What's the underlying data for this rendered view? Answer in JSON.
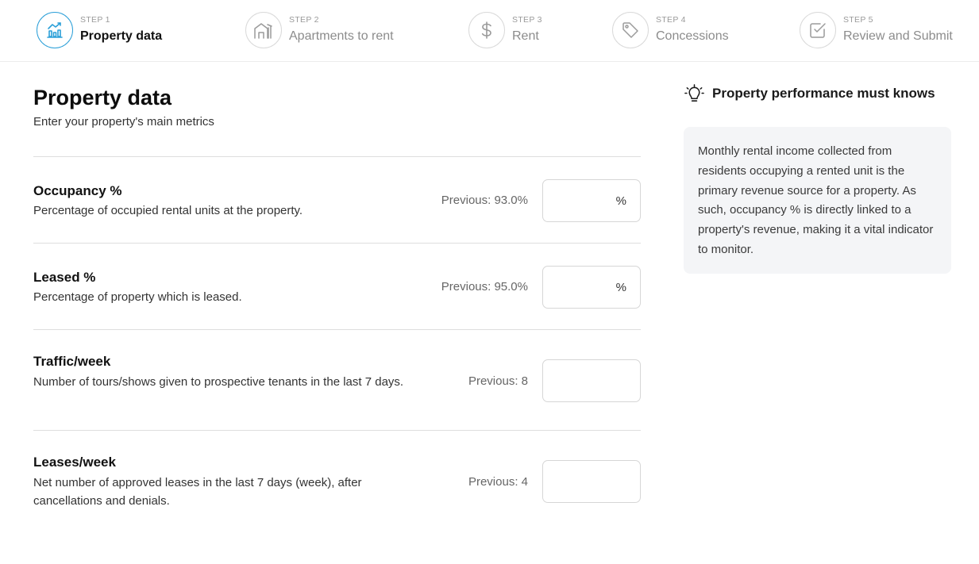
{
  "steps": [
    {
      "number": "STEP 1",
      "title": "Property data",
      "icon": "bar-chart-icon",
      "active": true
    },
    {
      "number": "STEP 2",
      "title": "Apartments to rent",
      "icon": "building-icon",
      "active": false
    },
    {
      "number": "STEP 3",
      "title": "Rent",
      "icon": "dollar-icon",
      "active": false
    },
    {
      "number": "STEP 4",
      "title": "Concessions",
      "icon": "tag-icon",
      "active": false
    },
    {
      "number": "STEP 5",
      "title": "Review and Submit",
      "icon": "checkbox-icon",
      "active": false
    }
  ],
  "main": {
    "title": "Property data",
    "subtitle": "Enter your property's main metrics",
    "metrics": [
      {
        "label": "Occupancy %",
        "description": "Percentage of occupied rental units at the property.",
        "previous": "Previous: 93.0%",
        "value": "",
        "unit": "%"
      },
      {
        "label": "Leased %",
        "description": "Percentage of property which is leased.",
        "previous": "Previous: 95.0%",
        "value": "",
        "unit": "%"
      },
      {
        "label": "Traffic/week",
        "description": "Number of tours/shows given to prospective tenants in the last 7 days.",
        "previous": "Previous: 8",
        "value": "",
        "unit": ""
      },
      {
        "label": "Leases/week",
        "description": "Net number of approved leases in the last 7 days (week), after cancellations and denials.",
        "previous": "Previous: 4",
        "value": "",
        "unit": ""
      }
    ]
  },
  "tips": {
    "icon": "lightbulb-icon",
    "title": "Property performance must knows",
    "text": "Monthly rental income collected from residents occupying a rented unit is the primary revenue source for a property. As such, occupancy % is directly linked to a property's revenue, making it a vital indicator to monitor."
  },
  "colors": {
    "accent": "#2b9fd8",
    "panel_background": "#f4f5f7"
  }
}
